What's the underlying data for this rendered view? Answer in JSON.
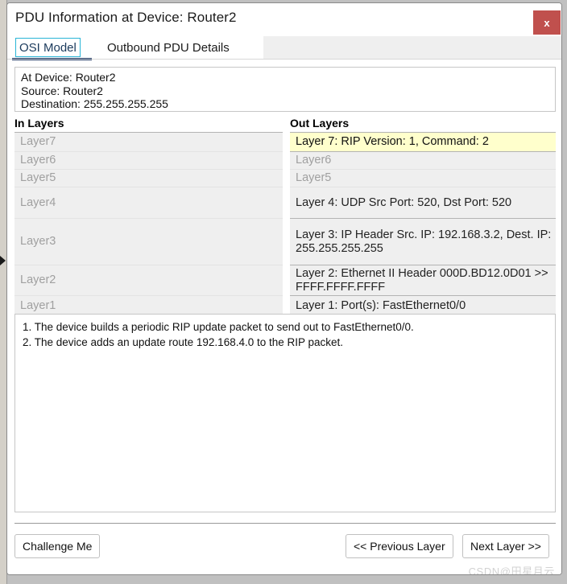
{
  "window": {
    "title": "PDU Information at Device: Router2",
    "close_label": "x"
  },
  "tabs": [
    {
      "label": "OSI Model",
      "selected": true
    },
    {
      "label": "Outbound PDU Details",
      "selected": false
    }
  ],
  "info": {
    "at_device": "At Device: Router2",
    "source": "Source: Router2",
    "destination": "Destination: 255.255.255.255"
  },
  "columns": {
    "in_header": "In Layers",
    "out_header": "Out Layers"
  },
  "in_layers": [
    {
      "label": "Layer7",
      "state": "dim"
    },
    {
      "label": "Layer6",
      "state": "dim"
    },
    {
      "label": "Layer5",
      "state": "dim"
    },
    {
      "label": "Layer4",
      "state": "dim"
    },
    {
      "label": "Layer3",
      "state": "dim"
    },
    {
      "label": "Layer2",
      "state": "dim"
    },
    {
      "label": "Layer1",
      "state": "dim"
    }
  ],
  "out_layers": [
    {
      "label": "Layer 7: RIP Version: 1, Command: 2",
      "state": "active"
    },
    {
      "label": "Layer6",
      "state": "dim"
    },
    {
      "label": "Layer5",
      "state": "dim"
    },
    {
      "label": "Layer 4: UDP Src Port: 520, Dst Port: 520",
      "state": "normal"
    },
    {
      "label": "Layer 3: IP Header Src. IP: 192.168.3.2, Dest. IP: 255.255.255.255",
      "state": "normal"
    },
    {
      "label": "Layer 2: Ethernet II Header 000D.BD12.0D01 >> FFFF.FFFF.FFFF",
      "state": "normal"
    },
    {
      "label": "Layer 1: Port(s): FastEthernet0/0",
      "state": "normal"
    }
  ],
  "description": {
    "line1": "1. The device builds a periodic RIP update packet to send out to FastEthernet0/0.",
    "line2": "2. The device adds an update route 192.168.4.0 to the RIP packet."
  },
  "buttons": {
    "challenge": "Challenge Me",
    "previous": "<< Previous Layer",
    "next": "Next Layer >>"
  },
  "watermark": "CSDN@田星月云",
  "colors": {
    "close_button": "#c0504d",
    "tab_focus_border": "#29b5d6",
    "tab_underline": "#1f3864",
    "active_row": "#ffffcc",
    "row_background": "#efefef",
    "dim_text": "#a0a0a0"
  }
}
